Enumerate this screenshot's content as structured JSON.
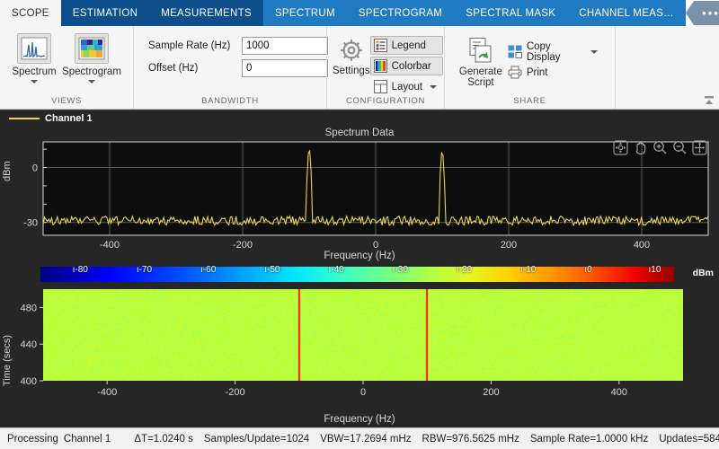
{
  "tabs": [
    {
      "label": "SCOPE",
      "state": "active"
    },
    {
      "label": "ESTIMATION",
      "state": "dark"
    },
    {
      "label": "MEASUREMENTS",
      "state": "dark"
    },
    {
      "label": "SPECTRUM",
      "state": "mid"
    },
    {
      "label": "SPECTROGRAM",
      "state": "mid"
    },
    {
      "label": "SPECTRAL MASK",
      "state": "mid"
    },
    {
      "label": "CHANNEL MEAS…",
      "state": "mid"
    }
  ],
  "tab_overflow_label": "•••",
  "ribbon": {
    "views": {
      "group_label": "VIEWS",
      "spectrum_button": "Spectrum",
      "spectrogram_button": "Spectrogram"
    },
    "bandwidth": {
      "group_label": "BANDWIDTH",
      "sample_rate_label": "Sample Rate (Hz)",
      "sample_rate_value": "1000",
      "offset_label": "Offset (Hz)",
      "offset_value": "0"
    },
    "configuration": {
      "group_label": "CONFIGURATION",
      "settings_button": "Settings",
      "legend_button": "Legend",
      "colorbar_button": "Colorbar",
      "layout_button": "Layout"
    },
    "share": {
      "group_label": "SHARE",
      "generate_script_button": "Generate Script",
      "copy_display_button": "Copy Display",
      "print_button": "Print"
    }
  },
  "legend": {
    "channel_label": "Channel 1",
    "channel_color": "#e8d44d"
  },
  "chart_data": [
    {
      "type": "line",
      "title": "Spectrum Data",
      "xlabel": "Frequency (Hz)",
      "ylabel": "dBm",
      "xlim": [
        -500,
        500
      ],
      "ylim": [
        -37,
        14
      ],
      "xticks": [
        -400,
        -200,
        0,
        200,
        400
      ],
      "yticks": [
        0,
        -30
      ],
      "grid": true,
      "series": [
        {
          "name": "Channel 1",
          "color": "#e8d44d",
          "noise_floor_dbm": -29,
          "noise_ripple_db": 2.5,
          "peaks": [
            {
              "frequency_hz": -100,
              "amplitude_dbm": 10
            },
            {
              "frequency_hz": 100,
              "amplitude_dbm": 9
            }
          ]
        }
      ]
    },
    {
      "type": "heatmap",
      "xlabel": "Frequency (Hz)",
      "ylabel": "Time (secs)",
      "xlim": [
        -500,
        500
      ],
      "ylim": [
        400,
        500
      ],
      "xticks": [
        -400,
        -200,
        0,
        200,
        400
      ],
      "yticks": [
        400,
        440,
        480
      ],
      "colormap": "jet",
      "background_level_dbm": -28,
      "tone_frequencies_hz": [
        -100,
        100
      ],
      "tone_level_dbm": 10
    }
  ],
  "colorbar": {
    "unit": "dBm",
    "ticks": [
      -80,
      -70,
      -60,
      -50,
      -40,
      -30,
      -20,
      -10,
      0,
      10
    ],
    "range": [
      -85,
      14
    ]
  },
  "statusbar": {
    "processing": "Processing",
    "channel": "Channel 1",
    "delta_t": "ΔT=1.0240 s",
    "samples_per_update": "Samples/Update=1024",
    "vbw": "VBW=17.2694 mHz",
    "rbw": "RBW=976.5625 mHz",
    "sample_rate": "Sample Rate=1.0000 kHz",
    "updates": "Updates=584"
  }
}
